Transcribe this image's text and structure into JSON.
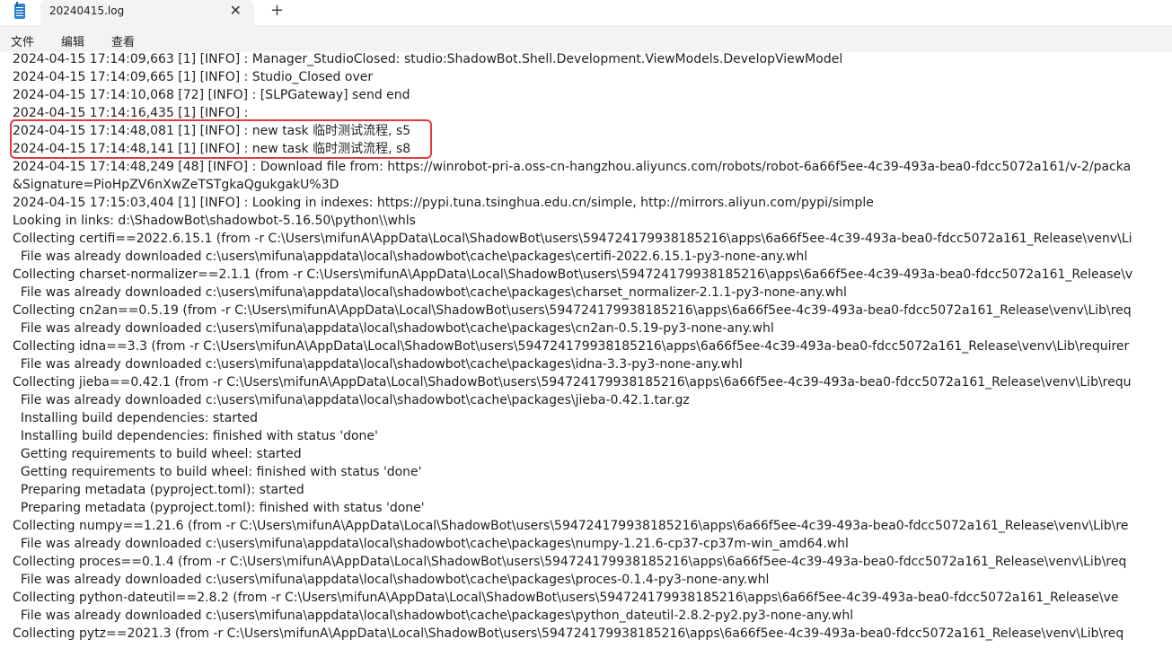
{
  "tab": {
    "title": "20240415.log",
    "close_glyph": "✕",
    "new_glyph": "+"
  },
  "menu": {
    "file": "文件",
    "edit": "编辑",
    "view": "查看"
  },
  "colors": {
    "highlight_border": "#e13c3c",
    "menubar_bg": "#f3f3f3",
    "tab_bg": "#f3f3f3"
  },
  "icons": {
    "app": "notepad-icon",
    "close": "close-icon",
    "new_tab": "plus-icon"
  },
  "log_lines": [
    "2024-04-15 17:14:09,663 [1] [INFO] : Manager_StudioClosed: studio:ShadowBot.Shell.Development.ViewModels.DevelopViewModel",
    "2024-04-15 17:14:09,665 [1] [INFO] : Studio_Closed over",
    "2024-04-15 17:14:10,068 [72] [INFO] : [SLPGateway] send end",
    "2024-04-15 17:14:16,435 [1] [INFO] :",
    "2024-04-15 17:14:48,081 [1] [INFO] : new task 临时测试流程, s5",
    "2024-04-15 17:14:48,141 [1] [INFO] : new task 临时测试流程, s8",
    "2024-04-15 17:14:48,249 [48] [INFO] : Download file from: https://winrobot-pri-a.oss-cn-hangzhou.aliyuncs.com/robots/robot-6a66f5ee-4c39-493a-bea0-fdcc5072a161/v-2/packa",
    "&Signature=PioHpZV6nXwZeTSTgkaQgukgakU%3D",
    "2024-04-15 17:15:03,404 [1] [INFO] : Looking in indexes: https://pypi.tuna.tsinghua.edu.cn/simple, http://mirrors.aliyun.com/pypi/simple",
    "Looking in links: d:\\ShadowBot\\shadowbot-5.16.50\\python\\\\whls",
    "Collecting certifi==2022.6.15.1 (from -r C:\\Users\\mifunA\\AppData\\Local\\ShadowBot\\users\\594724179938185216\\apps\\6a66f5ee-4c39-493a-bea0-fdcc5072a161_Release\\venv\\Li",
    "  File was already downloaded c:\\users\\mifuna\\appdata\\local\\shadowbot\\cache\\packages\\certifi-2022.6.15.1-py3-none-any.whl",
    "Collecting charset-normalizer==2.1.1 (from -r C:\\Users\\mifunA\\AppData\\Local\\ShadowBot\\users\\594724179938185216\\apps\\6a66f5ee-4c39-493a-bea0-fdcc5072a161_Release\\v",
    "  File was already downloaded c:\\users\\mifuna\\appdata\\local\\shadowbot\\cache\\packages\\charset_normalizer-2.1.1-py3-none-any.whl",
    "Collecting cn2an==0.5.19 (from -r C:\\Users\\mifunA\\AppData\\Local\\ShadowBot\\users\\594724179938185216\\apps\\6a66f5ee-4c39-493a-bea0-fdcc5072a161_Release\\venv\\Lib\\req",
    "  File was already downloaded c:\\users\\mifuna\\appdata\\local\\shadowbot\\cache\\packages\\cn2an-0.5.19-py3-none-any.whl",
    "Collecting idna==3.3 (from -r C:\\Users\\mifunA\\AppData\\Local\\ShadowBot\\users\\594724179938185216\\apps\\6a66f5ee-4c39-493a-bea0-fdcc5072a161_Release\\venv\\Lib\\requirer",
    "  File was already downloaded c:\\users\\mifuna\\appdata\\local\\shadowbot\\cache\\packages\\idna-3.3-py3-none-any.whl",
    "Collecting jieba==0.42.1 (from -r C:\\Users\\mifunA\\AppData\\Local\\ShadowBot\\users\\594724179938185216\\apps\\6a66f5ee-4c39-493a-bea0-fdcc5072a161_Release\\venv\\Lib\\requ",
    "  File was already downloaded c:\\users\\mifuna\\appdata\\local\\shadowbot\\cache\\packages\\jieba-0.42.1.tar.gz",
    "  Installing build dependencies: started",
    "  Installing build dependencies: finished with status 'done'",
    "  Getting requirements to build wheel: started",
    "  Getting requirements to build wheel: finished with status 'done'",
    "  Preparing metadata (pyproject.toml): started",
    "  Preparing metadata (pyproject.toml): finished with status 'done'",
    "Collecting numpy==1.21.6 (from -r C:\\Users\\mifunA\\AppData\\Local\\ShadowBot\\users\\594724179938185216\\apps\\6a66f5ee-4c39-493a-bea0-fdcc5072a161_Release\\venv\\Lib\\re",
    "  File was already downloaded c:\\users\\mifuna\\appdata\\local\\shadowbot\\cache\\packages\\numpy-1.21.6-cp37-cp37m-win_amd64.whl",
    "Collecting proces==0.1.4 (from -r C:\\Users\\mifunA\\AppData\\Local\\ShadowBot\\users\\594724179938185216\\apps\\6a66f5ee-4c39-493a-bea0-fdcc5072a161_Release\\venv\\Lib\\req",
    "  File was already downloaded c:\\users\\mifuna\\appdata\\local\\shadowbot\\cache\\packages\\proces-0.1.4-py3-none-any.whl",
    "Collecting python-dateutil==2.8.2 (from -r C:\\Users\\mifunA\\AppData\\Local\\ShadowBot\\users\\594724179938185216\\apps\\6a66f5ee-4c39-493a-bea0-fdcc5072a161_Release\\ve",
    "  File was already downloaded c:\\users\\mifuna\\appdata\\local\\shadowbot\\cache\\packages\\python_dateutil-2.8.2-py2.py3-none-any.whl",
    "Collecting pytz==2021.3 (from -r C:\\Users\\mifunA\\AppData\\Local\\ShadowBot\\users\\594724179938185216\\apps\\6a66f5ee-4c39-493a-bea0-fdcc5072a161_Release\\venv\\Lib\\req"
  ]
}
